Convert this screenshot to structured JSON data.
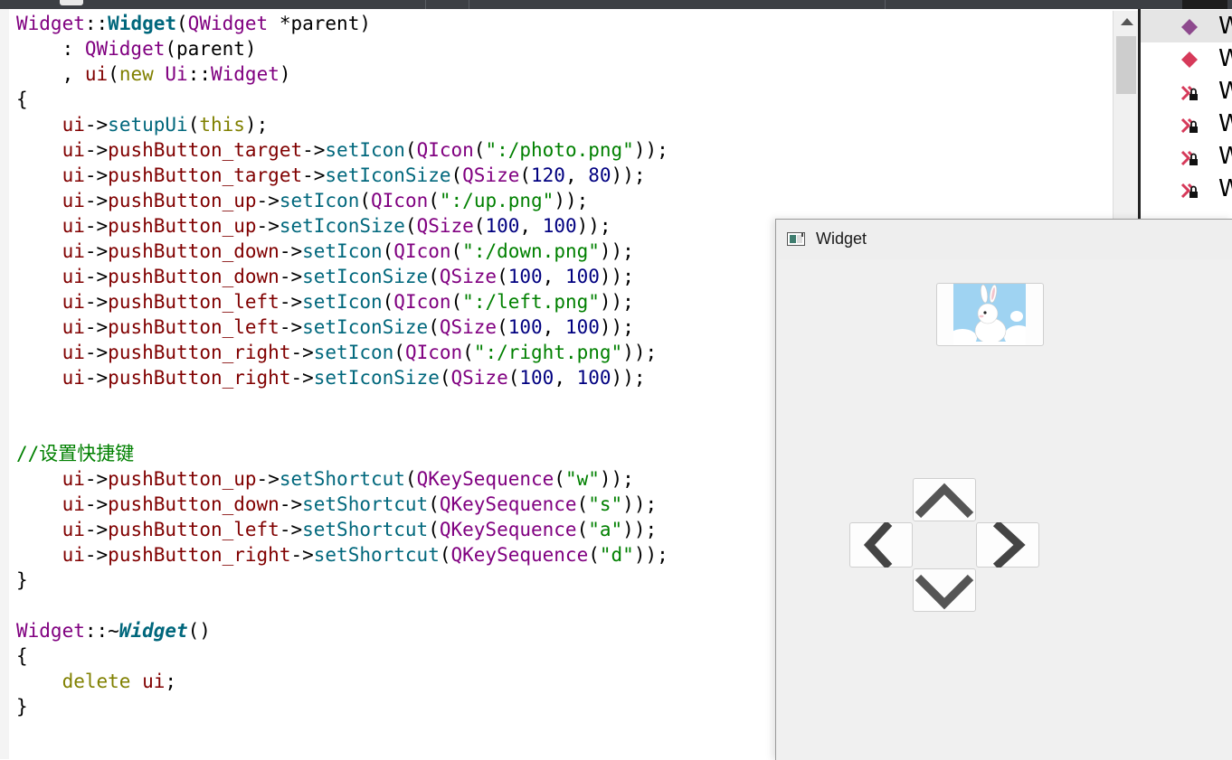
{
  "window": {
    "title": "Widget"
  },
  "side_panel": {
    "items": [
      {
        "label": "W",
        "icon": "purple-diamond-icon",
        "color": "#8e4a8e"
      },
      {
        "label": "W",
        "icon": "red-diamond-icon",
        "color": "#d63a5a"
      },
      {
        "label": "W",
        "icon": "locked-member-icon",
        "color": "#d63a5a"
      },
      {
        "label": "W",
        "icon": "locked-member-icon",
        "color": "#d63a5a"
      },
      {
        "label": "W",
        "icon": "locked-member-icon",
        "color": "#d63a5a"
      },
      {
        "label": "W",
        "icon": "locked-member-icon",
        "color": "#d63a5a"
      }
    ]
  },
  "code": {
    "lines": [
      [
        [
          "Widget",
          "cls"
        ],
        [
          "::",
          ""
        ],
        [
          "Widget",
          "bold"
        ],
        [
          "(",
          ""
        ],
        [
          "QWidget",
          "cls"
        ],
        [
          " *parent)",
          ""
        ]
      ],
      [
        [
          "    : ",
          ""
        ],
        [
          "QWidget",
          "cls"
        ],
        [
          "(parent)",
          ""
        ]
      ],
      [
        [
          "    , ",
          ""
        ],
        [
          "ui",
          "mem"
        ],
        [
          "(",
          ""
        ],
        [
          "new",
          "kw"
        ],
        [
          " ",
          ""
        ],
        [
          "Ui",
          "cls"
        ],
        [
          "::",
          ""
        ],
        [
          "Widget",
          "cls"
        ],
        [
          ")",
          ""
        ]
      ],
      [
        [
          "{",
          ""
        ]
      ],
      [
        [
          "    ",
          ""
        ],
        [
          "ui",
          "mem"
        ],
        [
          "->",
          ""
        ],
        [
          "setupUi",
          "fn"
        ],
        [
          "(",
          ""
        ],
        [
          "this",
          "kw"
        ],
        [
          ");",
          ""
        ]
      ],
      [
        [
          "    ",
          ""
        ],
        [
          "ui",
          "mem"
        ],
        [
          "->",
          ""
        ],
        [
          "pushButton_target",
          "mem"
        ],
        [
          "->",
          ""
        ],
        [
          "setIcon",
          "fn"
        ],
        [
          "(",
          ""
        ],
        [
          "QIcon",
          "cls"
        ],
        [
          "(",
          ""
        ],
        [
          "\":/photo.png\"",
          "str"
        ],
        [
          "));",
          ""
        ]
      ],
      [
        [
          "    ",
          ""
        ],
        [
          "ui",
          "mem"
        ],
        [
          "->",
          ""
        ],
        [
          "pushButton_target",
          "mem"
        ],
        [
          "->",
          ""
        ],
        [
          "setIconSize",
          "fn"
        ],
        [
          "(",
          ""
        ],
        [
          "QSize",
          "cls"
        ],
        [
          "(",
          ""
        ],
        [
          "120",
          "num"
        ],
        [
          ", ",
          ""
        ],
        [
          "80",
          "num"
        ],
        [
          "));",
          ""
        ]
      ],
      [
        [
          "    ",
          ""
        ],
        [
          "ui",
          "mem"
        ],
        [
          "->",
          ""
        ],
        [
          "pushButton_up",
          "mem"
        ],
        [
          "->",
          ""
        ],
        [
          "setIcon",
          "fn"
        ],
        [
          "(",
          ""
        ],
        [
          "QIcon",
          "cls"
        ],
        [
          "(",
          ""
        ],
        [
          "\":/up.png\"",
          "str"
        ],
        [
          "));",
          ""
        ]
      ],
      [
        [
          "    ",
          ""
        ],
        [
          "ui",
          "mem"
        ],
        [
          "->",
          ""
        ],
        [
          "pushButton_up",
          "mem"
        ],
        [
          "->",
          ""
        ],
        [
          "setIconSize",
          "fn"
        ],
        [
          "(",
          ""
        ],
        [
          "QSize",
          "cls"
        ],
        [
          "(",
          ""
        ],
        [
          "100",
          "num"
        ],
        [
          ", ",
          ""
        ],
        [
          "100",
          "num"
        ],
        [
          "));",
          ""
        ]
      ],
      [
        [
          "    ",
          ""
        ],
        [
          "ui",
          "mem"
        ],
        [
          "->",
          ""
        ],
        [
          "pushButton_down",
          "mem"
        ],
        [
          "->",
          ""
        ],
        [
          "setIcon",
          "fn"
        ],
        [
          "(",
          ""
        ],
        [
          "QIcon",
          "cls"
        ],
        [
          "(",
          ""
        ],
        [
          "\":/down.png\"",
          "str"
        ],
        [
          "));",
          ""
        ]
      ],
      [
        [
          "    ",
          ""
        ],
        [
          "ui",
          "mem"
        ],
        [
          "->",
          ""
        ],
        [
          "pushButton_down",
          "mem"
        ],
        [
          "->",
          ""
        ],
        [
          "setIconSize",
          "fn"
        ],
        [
          "(",
          ""
        ],
        [
          "QSize",
          "cls"
        ],
        [
          "(",
          ""
        ],
        [
          "100",
          "num"
        ],
        [
          ", ",
          ""
        ],
        [
          "100",
          "num"
        ],
        [
          "));",
          ""
        ]
      ],
      [
        [
          "    ",
          ""
        ],
        [
          "ui",
          "mem"
        ],
        [
          "->",
          ""
        ],
        [
          "pushButton_left",
          "mem"
        ],
        [
          "->",
          ""
        ],
        [
          "setIcon",
          "fn"
        ],
        [
          "(",
          ""
        ],
        [
          "QIcon",
          "cls"
        ],
        [
          "(",
          ""
        ],
        [
          "\":/left.png\"",
          "str"
        ],
        [
          "));",
          ""
        ]
      ],
      [
        [
          "    ",
          ""
        ],
        [
          "ui",
          "mem"
        ],
        [
          "->",
          ""
        ],
        [
          "pushButton_left",
          "mem"
        ],
        [
          "->",
          ""
        ],
        [
          "setIconSize",
          "fn"
        ],
        [
          "(",
          ""
        ],
        [
          "QSize",
          "cls"
        ],
        [
          "(",
          ""
        ],
        [
          "100",
          "num"
        ],
        [
          ", ",
          ""
        ],
        [
          "100",
          "num"
        ],
        [
          "));",
          ""
        ]
      ],
      [
        [
          "    ",
          ""
        ],
        [
          "ui",
          "mem"
        ],
        [
          "->",
          ""
        ],
        [
          "pushButton_right",
          "mem"
        ],
        [
          "->",
          ""
        ],
        [
          "setIcon",
          "fn"
        ],
        [
          "(",
          ""
        ],
        [
          "QIcon",
          "cls"
        ],
        [
          "(",
          ""
        ],
        [
          "\":/right.png\"",
          "str"
        ],
        [
          "));",
          ""
        ]
      ],
      [
        [
          "    ",
          ""
        ],
        [
          "ui",
          "mem"
        ],
        [
          "->",
          ""
        ],
        [
          "pushButton_right",
          "mem"
        ],
        [
          "->",
          ""
        ],
        [
          "setIconSize",
          "fn"
        ],
        [
          "(",
          ""
        ],
        [
          "QSize",
          "cls"
        ],
        [
          "(",
          ""
        ],
        [
          "100",
          "num"
        ],
        [
          ", ",
          ""
        ],
        [
          "100",
          "num"
        ],
        [
          "));",
          ""
        ]
      ],
      [],
      [],
      [
        [
          "//设置快捷键",
          "cmt"
        ]
      ],
      [
        [
          "    ",
          ""
        ],
        [
          "ui",
          "mem"
        ],
        [
          "->",
          ""
        ],
        [
          "pushButton_up",
          "mem"
        ],
        [
          "->",
          ""
        ],
        [
          "setShortcut",
          "fn"
        ],
        [
          "(",
          ""
        ],
        [
          "QKeySequence",
          "cls"
        ],
        [
          "(",
          ""
        ],
        [
          "\"w\"",
          "str"
        ],
        [
          "));",
          ""
        ]
      ],
      [
        [
          "    ",
          ""
        ],
        [
          "ui",
          "mem"
        ],
        [
          "->",
          ""
        ],
        [
          "pushButton_down",
          "mem"
        ],
        [
          "->",
          ""
        ],
        [
          "setShortcut",
          "fn"
        ],
        [
          "(",
          ""
        ],
        [
          "QKeySequence",
          "cls"
        ],
        [
          "(",
          ""
        ],
        [
          "\"s\"",
          "str"
        ],
        [
          "));",
          ""
        ]
      ],
      [
        [
          "    ",
          ""
        ],
        [
          "ui",
          "mem"
        ],
        [
          "->",
          ""
        ],
        [
          "pushButton_left",
          "mem"
        ],
        [
          "->",
          ""
        ],
        [
          "setShortcut",
          "fn"
        ],
        [
          "(",
          ""
        ],
        [
          "QKeySequence",
          "cls"
        ],
        [
          "(",
          ""
        ],
        [
          "\"a\"",
          "str"
        ],
        [
          "));",
          ""
        ]
      ],
      [
        [
          "    ",
          ""
        ],
        [
          "ui",
          "mem"
        ],
        [
          "->",
          ""
        ],
        [
          "pushButton_right",
          "mem"
        ],
        [
          "->",
          ""
        ],
        [
          "setShortcut",
          "fn"
        ],
        [
          "(",
          ""
        ],
        [
          "QKeySequence",
          "cls"
        ],
        [
          "(",
          ""
        ],
        [
          "\"d\"",
          "str"
        ],
        [
          "));",
          ""
        ]
      ],
      [
        [
          "}",
          ""
        ]
      ],
      [],
      [
        [
          "Widget",
          "cls"
        ],
        [
          "::~",
          ""
        ],
        [
          "Widget",
          "italic"
        ],
        [
          "()",
          ""
        ]
      ],
      [
        [
          "{",
          ""
        ]
      ],
      [
        [
          "    ",
          ""
        ],
        [
          "delete",
          "kw"
        ],
        [
          " ",
          ""
        ],
        [
          "ui",
          "mem"
        ],
        [
          ";",
          ""
        ]
      ],
      [
        [
          "}",
          ""
        ]
      ]
    ]
  }
}
